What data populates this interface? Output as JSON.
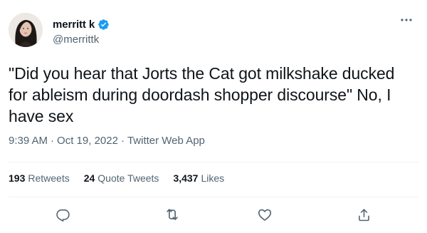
{
  "user": {
    "display_name": "merritt k",
    "handle": "@merrittk",
    "verified": true
  },
  "tweet": {
    "text": "\"Did you hear that Jorts the Cat got milkshake ducked for ableism during doordash shopper discourse\" No, I have sex",
    "time": "9:39 AM",
    "date": "Oct 19, 2022",
    "source": "Twitter Web App",
    "separator": "·"
  },
  "stats": {
    "retweets_count": "193",
    "retweets_label": "Retweets",
    "quote_count": "24",
    "quote_label": "Quote Tweets",
    "likes_count": "3,437",
    "likes_label": "Likes"
  },
  "icons": {
    "verified": "verified-badge-icon",
    "more": "more-horizontal-icon",
    "reply": "reply-icon",
    "retweet": "retweet-icon",
    "like": "heart-icon",
    "share": "share-icon"
  },
  "colors": {
    "text": "#0f1419",
    "secondary": "#536471",
    "verified": "#1d9bf0",
    "divider": "#eff3f4"
  }
}
